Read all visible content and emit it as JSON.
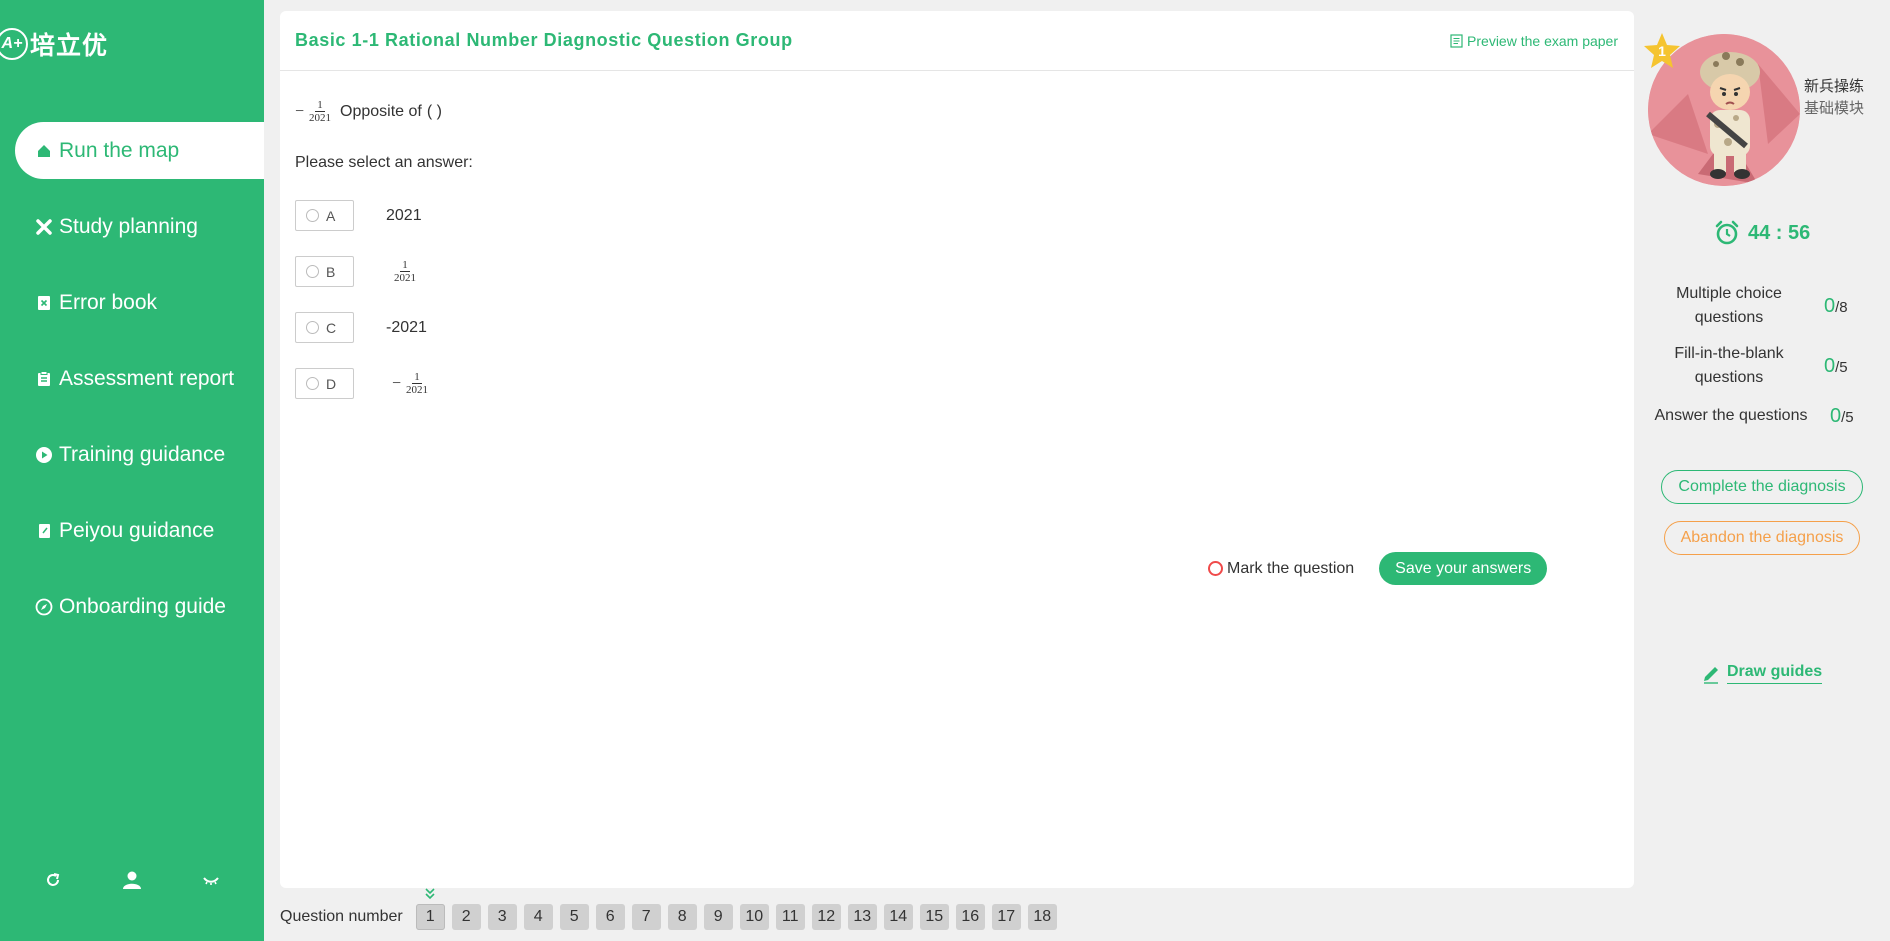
{
  "sidebar": {
    "logo_badge": "A+",
    "logo_text": "培立优",
    "items": [
      {
        "label": "Run the map",
        "icon": "home-icon"
      },
      {
        "label": "Study planning",
        "icon": "tools-icon"
      },
      {
        "label": "Error book",
        "icon": "error-book-icon"
      },
      {
        "label": "Assessment report",
        "icon": "clipboard-icon"
      },
      {
        "label": "Training guidance",
        "icon": "play-icon"
      },
      {
        "label": "Peiyou guidance",
        "icon": "note-icon"
      },
      {
        "label": "Onboarding guide",
        "icon": "compass-icon"
      }
    ],
    "bottom_icons": [
      "refresh-icon",
      "user-icon",
      "collapse-icon"
    ]
  },
  "main": {
    "title": "Basic 1-1 Rational Number Diagnostic Question Group",
    "preview_label": "Preview the exam paper",
    "question": {
      "neg": "−",
      "numerator": "1",
      "denominator": "2021",
      "text": "Opposite of",
      "blank": "( )"
    },
    "prompt": "Please select an answer:",
    "options": [
      {
        "letter": "A",
        "value": "2021"
      },
      {
        "letter": "B",
        "numerator": "1",
        "denominator": "2021"
      },
      {
        "letter": "C",
        "value": "-2021"
      },
      {
        "letter": "D",
        "neg": "−",
        "numerator": "1",
        "denominator": "2021"
      }
    ],
    "mark_label": "Mark the question",
    "save_label": "Save your answers"
  },
  "question_bar": {
    "label": "Question number",
    "numbers": [
      "1",
      "2",
      "3",
      "4",
      "5",
      "6",
      "7",
      "8",
      "9",
      "10",
      "11",
      "12",
      "13",
      "14",
      "15",
      "16",
      "17",
      "18"
    ],
    "current": "1"
  },
  "right": {
    "level": "1",
    "rank_title": "新兵操练",
    "rank_sub": "基础模块",
    "timer": "44 : 56",
    "stats": [
      {
        "label": "Multiple choice questions",
        "done": "0",
        "total": "/8"
      },
      {
        "label": "Fill-in-the-blank questions",
        "done": "0",
        "total": "/5"
      },
      {
        "label": "Answer the questions",
        "done": "0",
        "total": "/5"
      }
    ],
    "complete_label": "Complete the diagnosis",
    "abandon_label": "Abandon the diagnosis",
    "draw_label": "Draw guides"
  },
  "colors": {
    "accent": "#2db875",
    "warning": "#f5a04a",
    "mark": "#f04a4a"
  }
}
